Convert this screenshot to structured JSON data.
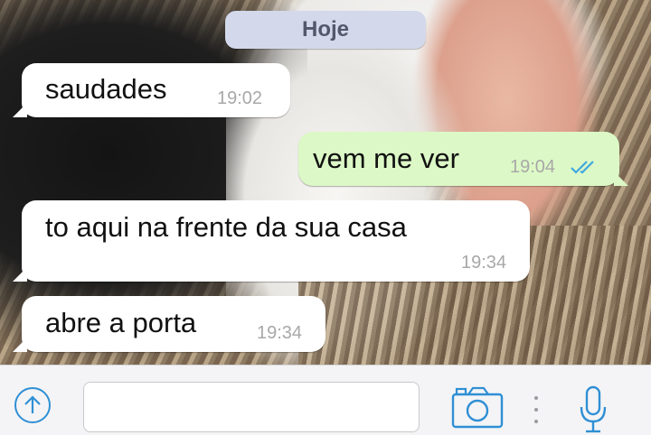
{
  "chat": {
    "date_divider": "Hoje",
    "messages": [
      {
        "direction": "incoming",
        "text": "saudades",
        "time": "19:02"
      },
      {
        "direction": "outgoing",
        "text": "vem me ver",
        "time": "19:04",
        "status": "read"
      },
      {
        "direction": "incoming",
        "text": "to aqui na frente da sua casa",
        "time": "19:34"
      },
      {
        "direction": "incoming",
        "text": "abre a porta",
        "time": "19:34"
      }
    ]
  },
  "input_bar": {
    "placeholder": "",
    "icons": {
      "attach": "upload-arrow-icon",
      "camera": "camera-icon",
      "mic": "microphone-icon"
    }
  },
  "colors": {
    "accent": "#2f8fd4",
    "incoming_bubble": "#ffffff",
    "outgoing_bubble": "#dcf8c6",
    "date_pill": "#d3d9ea",
    "read_ticks": "#3fa7e0"
  }
}
